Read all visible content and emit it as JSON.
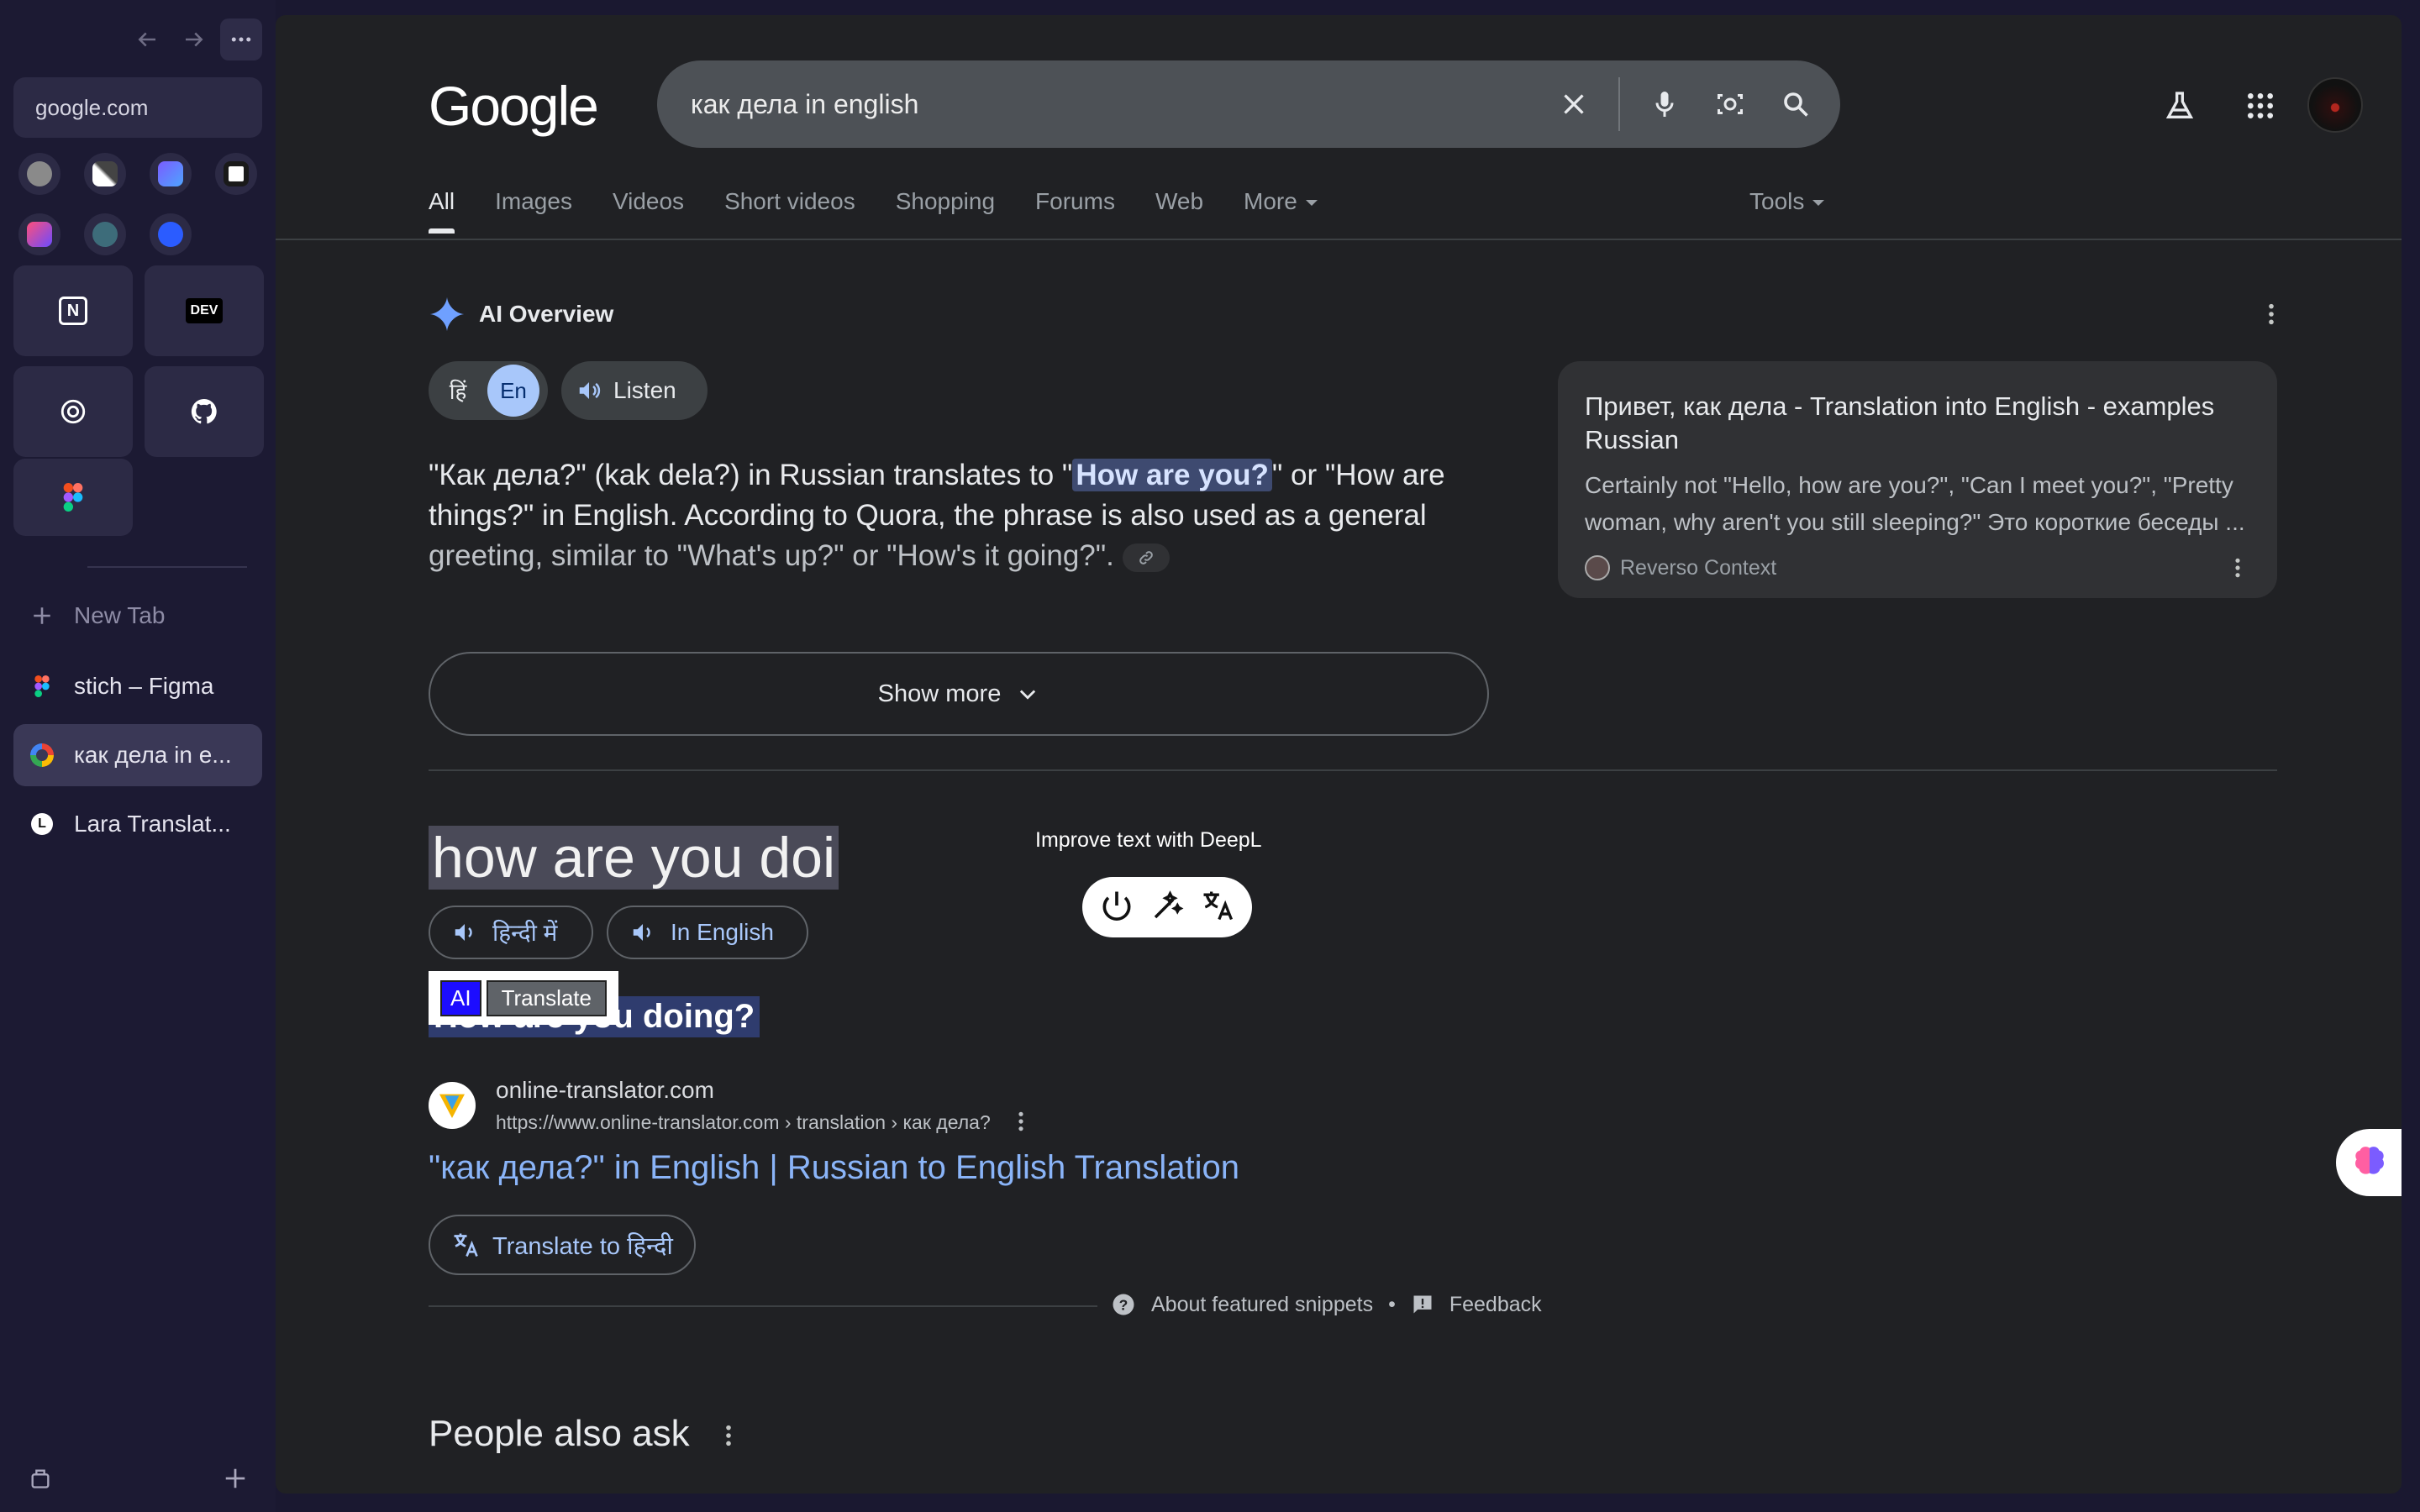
{
  "sidebar": {
    "url": "google.com",
    "new_tab_label": "New Tab",
    "tabs": [
      {
        "label": "stich – Figma",
        "icon": "figma-icon"
      },
      {
        "label": "как дела in e...",
        "icon": "google-icon"
      },
      {
        "label": "Lara Translat...",
        "icon": "lara-icon"
      }
    ],
    "pinned": [
      {
        "icon": "notion-icon",
        "text": "N"
      },
      {
        "icon": "dev-icon",
        "text": "DEV"
      },
      {
        "icon": "chatgpt-icon",
        "text": ""
      },
      {
        "icon": "github-icon",
        "text": ""
      },
      {
        "icon": "figma-icon",
        "text": ""
      }
    ]
  },
  "search": {
    "logo": "Google",
    "query": "как дела in english"
  },
  "tabs": [
    "All",
    "Images",
    "Videos",
    "Short videos",
    "Shopping",
    "Forums",
    "Web",
    "More"
  ],
  "tools_label": "Tools",
  "ai_overview": {
    "title": "AI Overview",
    "lang_hi": "हिं",
    "lang_en": "En",
    "listen": "Listen",
    "text_1": "\"Как дела?\" (kak dela?) in Russian translates to \"",
    "highlight": "How are you?",
    "text_2": "\" or \"How are things?\" in English. According to Quora, the phrase is also used as a general ",
    "text_3": "greeting, similar to \"What's up?\" or \"How's it going?\".",
    "source": {
      "title": "Привет, как дела - Translation into English - examples Russian",
      "snippet": "Certainly not \"Hello, how are you?\", \"Can I meet you?\", \"Pretty woman, why aren't you still sleeping?\" Это короткие беседы ...",
      "site": "Reverso Context"
    },
    "show_more": "Show more"
  },
  "featured": {
    "heading": "how are you doing?",
    "heading_visible": "how are you doi",
    "listen_hi": "हिन्दी में",
    "listen_en": "In English",
    "deepl_tooltip": "Improve text with DeepL",
    "ai_badge": "AI",
    "translate_badge": "Translate",
    "sub_answer": "How are you doing?",
    "site_name": "online-translator.com",
    "site_url": "https://www.online-translator.com › translation › как дела?",
    "result_title": "\"как дела?\" in English | Russian to English Translation",
    "translate_to": "Translate to हिन्दी",
    "about_snippets": "About featured snippets",
    "bullet": "•",
    "feedback": "Feedback"
  },
  "people_also_ask": "People also ask",
  "colors": {
    "accent": "#8ab4f8",
    "background": "#202124",
    "sidebar": "#1c1a33"
  }
}
